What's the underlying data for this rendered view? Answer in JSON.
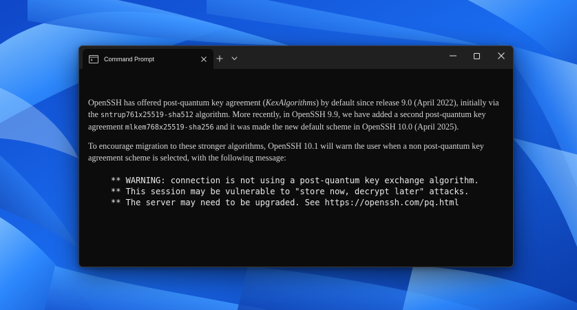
{
  "window": {
    "tab_title": "Command Prompt"
  },
  "terminal": {
    "p1": {
      "t1": "OpenSSH has offered post-quantum key agreement (",
      "em1": "KexAlgorithms",
      "t2": ") by default since release 9.0 (April 2022), initially via the ",
      "code1": "sntrup761x25519-sha512",
      "t3": " algorithm. More recently, in OpenSSH 9.9, we have added a second post-quantum key agreement ",
      "code2": "mlkem768x25519-sha256",
      "t4": " and it was made the new default scheme in OpenSSH 10.0 (April 2025)."
    },
    "p2": "To encourage migration to these stronger algorithms, OpenSSH 10.1 will warn the user when a non post-quantum key agreement scheme is selected, with the following message:",
    "warning_lines": [
      "** WARNING: connection is not using a post-quantum key exchange algorithm.",
      "** This session may be vulnerable to \"store now, decrypt later\" attacks.",
      "** The server may need to be upgraded. See https://openssh.com/pq.html"
    ]
  },
  "icons": {
    "tab": "terminal-icon",
    "tab_close": "close-icon",
    "new_tab": "plus-icon",
    "dropdown": "chevron-down-icon",
    "minimize": "minimize-icon",
    "maximize": "maximize-icon",
    "close": "close-icon"
  },
  "colors": {
    "terminal_bg": "#0c0c0c",
    "titlebar_bg": "#202020",
    "text": "#d4d4d4",
    "wallpaper_blue": "#1660e8"
  }
}
